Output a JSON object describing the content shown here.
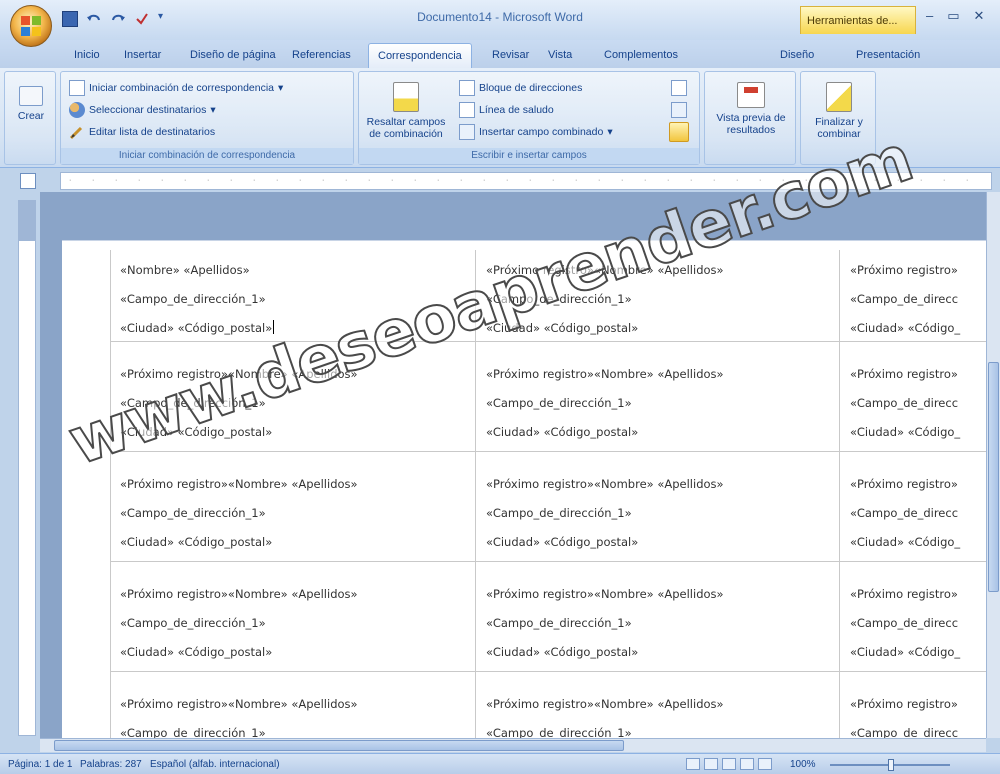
{
  "app": {
    "title": "Documento14 - Microsoft Word",
    "context_tools": "Herramientas de...",
    "window_controls": [
      "–",
      "▭",
      "✕"
    ]
  },
  "tabs": [
    {
      "label": "Inicio"
    },
    {
      "label": "Insertar"
    },
    {
      "label": "Diseño de página"
    },
    {
      "label": "Referencias"
    },
    {
      "label": "Correspondencia",
      "active": true
    },
    {
      "label": "Revisar"
    },
    {
      "label": "Vista"
    },
    {
      "label": "Complementos"
    },
    {
      "label": "Diseño"
    },
    {
      "label": "Presentación"
    }
  ],
  "ribbon": {
    "crear": {
      "label": "Crear"
    },
    "iniciar": {
      "items": [
        "Iniciar combinación de correspondencia",
        "Seleccionar destinatarios",
        "Editar lista de destinatarios"
      ],
      "group_label": "Iniciar combinación de correspondencia"
    },
    "escribir": {
      "resaltar": [
        "Resaltar campos",
        "de combinación"
      ],
      "items": [
        "Bloque de direcciones",
        "Línea de saludo",
        "Insertar campo combinado"
      ],
      "group_label": "Escribir e insertar campos"
    },
    "vista_previa": {
      "label": [
        "Vista previa de",
        "resultados"
      ]
    },
    "finalizar": {
      "label": [
        "Finalizar y",
        "combinar"
      ]
    }
  },
  "labels": {
    "first": {
      "line1": "«Nombre» «Apellidos»",
      "line2": "«Campo_de_dirección_1»",
      "line3": "«Ciudad» «Código_postal»"
    },
    "next": {
      "line1": "«Próximo registro»«Nombre» «Apellidos»",
      "line2": "«Campo_de_dirección_1»",
      "line3": "«Ciudad» «Código_postal»"
    },
    "next_partial": {
      "line1": "«Próximo registro»",
      "line2": "«Campo_de_direcc",
      "line3": "«Ciudad» «Código_"
    }
  },
  "watermark": "www.deseoaprender.com",
  "statusbar": {
    "page": "Página: 1 de 1",
    "words": "Palabras: 287",
    "language": "Español (alfab. internacional)",
    "zoom": "100%"
  }
}
